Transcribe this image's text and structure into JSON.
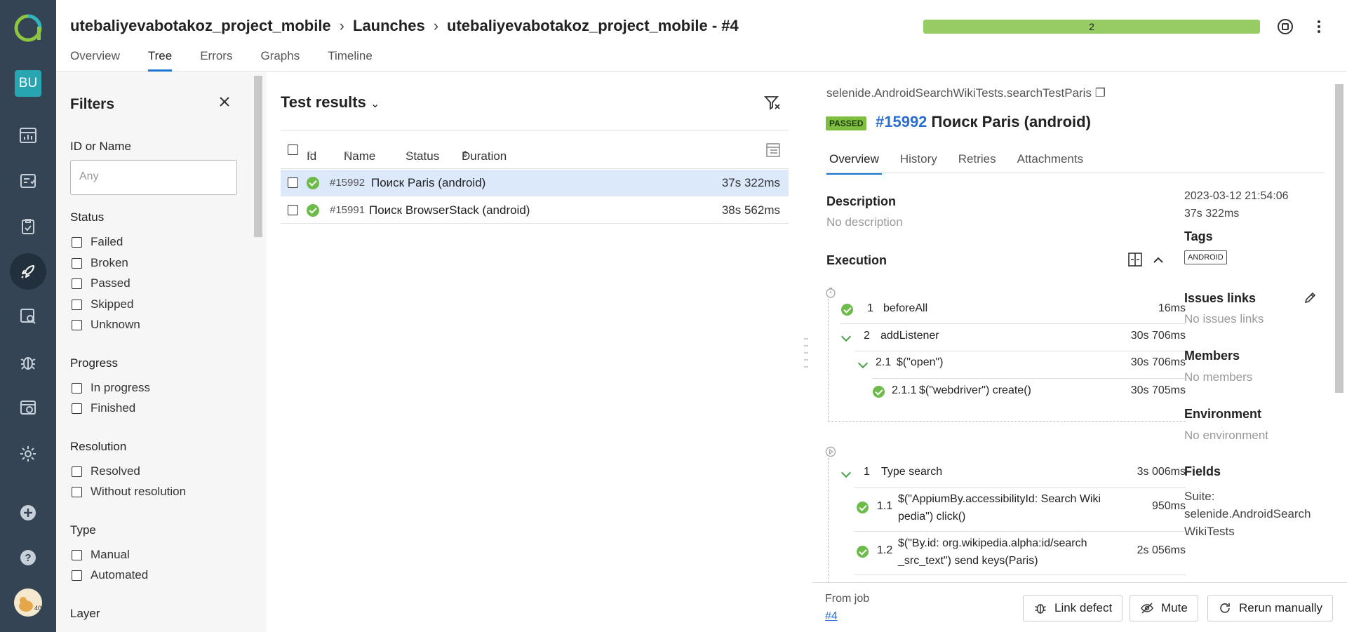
{
  "rail": {
    "user_initials": "BU",
    "avatar_badge": "40"
  },
  "header": {
    "breadcrumb": [
      "utebaliyevabotakoz_project_mobile",
      "Launches",
      "utebaliyevabotakoz_project_mobile - #4"
    ],
    "tabs": [
      "Overview",
      "Tree",
      "Errors",
      "Graphs",
      "Timeline"
    ],
    "active_tab": "Tree",
    "progress_label": "2",
    "progress_fraction": 1.0,
    "progress_color": "#97cc64"
  },
  "filters": {
    "title": "Filters",
    "id_label": "ID or Name",
    "id_placeholder": "Any",
    "status_label": "Status",
    "status_options": [
      "Failed",
      "Broken",
      "Passed",
      "Skipped",
      "Unknown"
    ],
    "progress_label": "Progress",
    "progress_options": [
      "In progress",
      "Finished"
    ],
    "resolution_label": "Resolution",
    "resolution_options": [
      "Resolved",
      "Without resolution"
    ],
    "type_label": "Type",
    "type_options": [
      "Manual",
      "Automated"
    ],
    "layer_label": "Layer"
  },
  "results": {
    "title": "Test results",
    "columns": [
      "Id",
      "Name",
      "Status",
      "Duration"
    ],
    "rows": [
      {
        "id": "#15992",
        "name": "Поиск Paris (android)",
        "duration": "37s 322ms",
        "selected": true
      },
      {
        "id": "#15991",
        "name": "Поиск BrowserStack (android)",
        "duration": "38s 562ms",
        "selected": false
      }
    ]
  },
  "detail": {
    "path": "selenide.AndroidSearchWikiTests.searchTestParis",
    "status_badge": "PASSED",
    "test_id": "#15992",
    "test_name": "Поиск Paris (android)",
    "tabs": [
      "Overview",
      "History",
      "Retries",
      "Attachments"
    ],
    "description_label": "Description",
    "description_value": "No description",
    "execution_label": "Execution",
    "timestamp": "2023-03-12 21:54:06",
    "duration": "37s 322ms",
    "tags_label": "Tags",
    "tag": "ANDROID",
    "issues_label": "Issues links",
    "issues_value": "No issues links",
    "members_label": "Members",
    "members_value": "No members",
    "environment_label": "Environment",
    "environment_value": "No environment",
    "fields_label": "Fields",
    "fields_value_1": "Suite:",
    "fields_value_2": "selenide.AndroidSearch",
    "fields_value_3": "WikiTests",
    "setup_steps": [
      {
        "num": "1",
        "name": "beforeAll",
        "dur": "16ms"
      },
      {
        "num": "2",
        "name": "addListener",
        "dur": "30s 706ms"
      },
      {
        "num": "2.1",
        "name": "$(\"open\")",
        "dur": "30s 706ms"
      },
      {
        "num": "2.1.1",
        "name": "$(\"webdriver\") create()",
        "dur": "30s 705ms"
      }
    ],
    "body_steps": [
      {
        "num": "1",
        "name": "Type search",
        "dur": "3s 006ms"
      },
      {
        "num": "1.1",
        "name_line1": "$(\"AppiumBy.accessibilityId: Search Wiki",
        "name_line2": "pedia\") click()",
        "dur": "950ms"
      },
      {
        "num": "1.2",
        "name_line1": "$(\"By.id: org.wikipedia.alpha:id/search",
        "name_line2": "_src_text\") send keys(Paris)",
        "dur": "2s 056ms"
      }
    ],
    "from_job_label": "From job",
    "from_job_link": "#4",
    "buttons": {
      "link_defect": "Link defect",
      "mute": "Mute",
      "rerun": "Rerun manually"
    }
  }
}
